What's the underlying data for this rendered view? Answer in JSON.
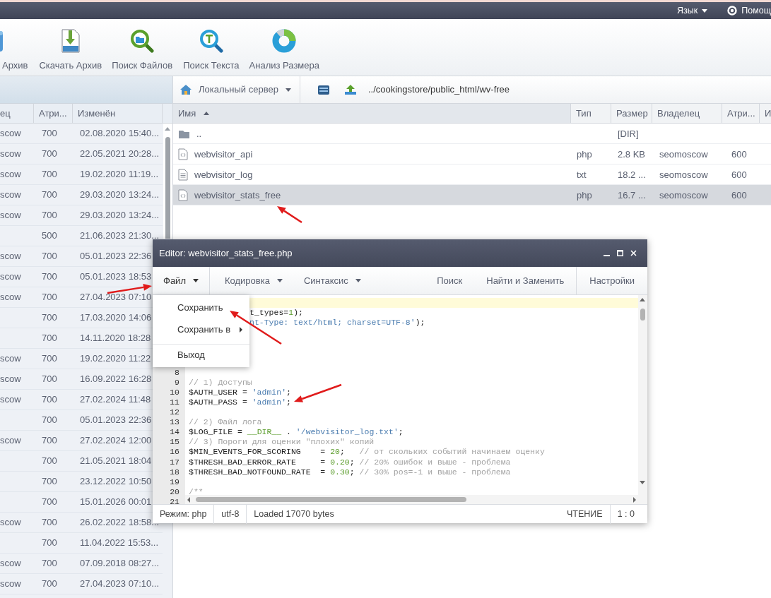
{
  "top_bar": {
    "menus": [
      {
        "kind": "language",
        "label": "Язык"
      },
      {
        "kind": "help",
        "label": "Помощ"
      }
    ]
  },
  "toolbar": {
    "tools": [
      {
        "kind": "archive",
        "label": "Архив"
      },
      {
        "kind": "zip",
        "label": "Скачать Архив"
      },
      {
        "kind": "find-files",
        "label": "Поиск Файлов"
      },
      {
        "kind": "find-text",
        "label": "Поиск Текста"
      },
      {
        "kind": "size",
        "label": "Анализ Размера"
      }
    ]
  },
  "left_panel": {
    "columns": [
      "ец",
      "Атри...",
      "Изменён"
    ],
    "rows": [
      {
        "owner": "scow",
        "attrs": "700",
        "modified": "02.08.2020 15:40..."
      },
      {
        "owner": "scow",
        "attrs": "700",
        "modified": "22.05.2021 20:28..."
      },
      {
        "owner": "scow",
        "attrs": "700",
        "modified": "19.02.2020 11:19..."
      },
      {
        "owner": "scow",
        "attrs": "700",
        "modified": "29.03.2020 13:24..."
      },
      {
        "owner": "scow",
        "attrs": "700",
        "modified": "29.03.2020 13:24..."
      },
      {
        "attrs": "500",
        "modified": "21.06.2023 21:30..."
      },
      {
        "owner": "scow",
        "attrs": "700",
        "modified": "05.01.2023 22:36"
      },
      {
        "owner": "scow",
        "attrs": "700",
        "modified": "05.01.2023 18:53"
      },
      {
        "owner": "scow",
        "attrs": "700",
        "modified": "27.04.2023 07:10"
      },
      {
        "attrs": "700",
        "modified": "17.03.2020 14:06"
      },
      {
        "attrs": "700",
        "modified": "14.11.2020 18:28"
      },
      {
        "owner": "scow",
        "attrs": "700",
        "modified": "19.02.2020 11:22"
      },
      {
        "owner": "scow",
        "attrs": "700",
        "modified": "16.09.2022 16:28"
      },
      {
        "owner": "scow",
        "attrs": "700",
        "modified": "27.02.2024 11:48"
      },
      {
        "attrs": "700",
        "modified": "05.01.2023 22:36"
      },
      {
        "owner": "scow",
        "attrs": "700",
        "modified": "27.02.2024 12:00"
      },
      {
        "attrs": "700",
        "modified": "21.05.2021 18:04"
      },
      {
        "attrs": "700",
        "modified": "23.12.2022 10:50"
      },
      {
        "attrs": "700",
        "modified": "15.01.2026 00:01"
      },
      {
        "owner": "scow",
        "attrs": "700",
        "modified": "26.02.2022 18:58..."
      },
      {
        "attrs": "700",
        "modified": "11.04.2022 15:53..."
      },
      {
        "owner": "scow",
        "attrs": "700",
        "modified": "07.09.2018 08:27..."
      },
      {
        "owner": "scow",
        "attrs": "700",
        "modified": "27.04.2023 07:10..."
      }
    ]
  },
  "right_panel": {
    "server": "Локальный сервер",
    "path": "../cookingstore/public_html/wv-free",
    "columns": [
      {
        "label": "Имя",
        "sorted": true
      },
      {
        "label": "Тип",
        "sorted": false
      },
      {
        "label": "Размер",
        "sorted": false
      },
      {
        "label": "Владелец",
        "sorted": false
      },
      {
        "label": "Атри...",
        "sorted": false
      },
      {
        "label": "И",
        "sorted": false
      }
    ],
    "rows": [
      {
        "kind": "folder",
        "name": "..",
        "size": "[DIR]",
        "selected": false
      },
      {
        "kind": "code",
        "name": "webvisitor_api",
        "type": "php",
        "size": "2.8 KB",
        "owner": "seomoscow",
        "attrs": "600",
        "selected": false
      },
      {
        "kind": "text",
        "name": "webvisitor_log",
        "type": "txt",
        "size": "18.2 ...",
        "owner": "seomoscow",
        "attrs": "600",
        "selected": false
      },
      {
        "kind": "code",
        "name": "webvisitor_stats_free",
        "type": "php",
        "size": "16.7 ...",
        "owner": "seomoscow",
        "attrs": "600",
        "selected": true
      }
    ]
  },
  "editor": {
    "title": "Editor: webvisitor_stats_free.php",
    "menus": [
      {
        "label": "Файл",
        "open": true
      },
      {
        "label": "Кодировка",
        "open": false
      },
      {
        "label": "Синтаксис",
        "open": false
      }
    ],
    "actions": [
      "Поиск",
      "Найти и Заменить",
      "Настройки"
    ],
    "file_menu": [
      {
        "label": "Сохранить",
        "submenu": false,
        "separator_before": false
      },
      {
        "label": "Сохранить в",
        "submenu": true,
        "separator_before": false
      },
      {
        "label": "Выход",
        "submenu": false,
        "separator_before": true
      }
    ],
    "lines": [
      {
        "current": true
      },
      {
        "current": false,
        "tokens": [
          {
            "kind": "code",
            "t": "t_types="
          },
          {
            "kind": "number",
            "t": "1"
          },
          {
            "kind": "code",
            "t": ");"
          }
        ]
      },
      {
        "current": false,
        "tokens": [
          {
            "kind": "string",
            "t": "nt-Type: text/html; charset=UTF-8'"
          },
          {
            "kind": "code",
            "t": ");"
          }
        ]
      },
      {
        "current": false
      },
      {
        "current": false
      },
      {
        "current": false
      },
      {
        "current": false
      },
      {
        "current": false,
        "number": "8"
      },
      {
        "current": false,
        "number": "9",
        "tokens": [
          {
            "kind": "comment",
            "t": "// 1) Доступы"
          }
        ]
      },
      {
        "current": false,
        "number": "10",
        "tokens": [
          {
            "kind": "code",
            "t": "$AUTH_USER = "
          },
          {
            "kind": "string",
            "t": "'admin'"
          },
          {
            "kind": "code",
            "t": ";"
          }
        ]
      },
      {
        "current": false,
        "number": "11",
        "tokens": [
          {
            "kind": "code",
            "t": "$AUTH_PASS = "
          },
          {
            "kind": "string",
            "t": "'admin'"
          },
          {
            "kind": "code",
            "t": ";"
          }
        ]
      },
      {
        "current": false,
        "number": "12"
      },
      {
        "current": false,
        "number": "13",
        "tokens": [
          {
            "kind": "comment",
            "t": "// 2) Файл лога"
          }
        ]
      },
      {
        "current": false,
        "number": "14",
        "tokens": [
          {
            "kind": "code",
            "t": "$LOG_FILE = "
          },
          {
            "kind": "constant",
            "t": "__DIR__"
          },
          {
            "kind": "code",
            "t": " . "
          },
          {
            "kind": "string",
            "t": "'/webvisitor_log.txt'"
          },
          {
            "kind": "code",
            "t": ";"
          }
        ]
      },
      {
        "current": false,
        "number": "15",
        "tokens": [
          {
            "kind": "comment",
            "t": "// 3) Пороги для оценки \"плохих\" копий"
          }
        ]
      },
      {
        "current": false,
        "number": "16",
        "tokens": [
          {
            "kind": "code",
            "t": "$MIN_EVENTS_FOR_SCORING    = "
          },
          {
            "kind": "number",
            "t": "20"
          },
          {
            "kind": "code",
            "t": ";   "
          },
          {
            "kind": "comment",
            "t": "// от скольких событий начинаем оценку"
          }
        ]
      },
      {
        "current": false,
        "number": "17",
        "tokens": [
          {
            "kind": "code",
            "t": "$THRESH_BAD_ERROR_RATE     = "
          },
          {
            "kind": "number",
            "t": "0.20"
          },
          {
            "kind": "code",
            "t": "; "
          },
          {
            "kind": "comment",
            "t": "// 20% ошибок и выше - проблема"
          }
        ]
      },
      {
        "current": false,
        "number": "18",
        "tokens": [
          {
            "kind": "code",
            "t": "$THRESH_BAD_NOTFOUND_RATE  = "
          },
          {
            "kind": "number",
            "t": "0.30"
          },
          {
            "kind": "code",
            "t": "; "
          },
          {
            "kind": "comment",
            "t": "// 30% pos=-1 и выше - проблема"
          }
        ]
      },
      {
        "current": false,
        "number": "19"
      },
      {
        "current": false,
        "number": "20",
        "tokens": [
          {
            "kind": "comment",
            "t": "/**"
          }
        ]
      },
      {
        "number": "21"
      }
    ],
    "status": {
      "mode": "Режим: php",
      "encoding": "utf-8",
      "info": "Loaded 17070 bytes",
      "access": "ЧТЕНИЕ",
      "position": "1 : 0"
    }
  }
}
